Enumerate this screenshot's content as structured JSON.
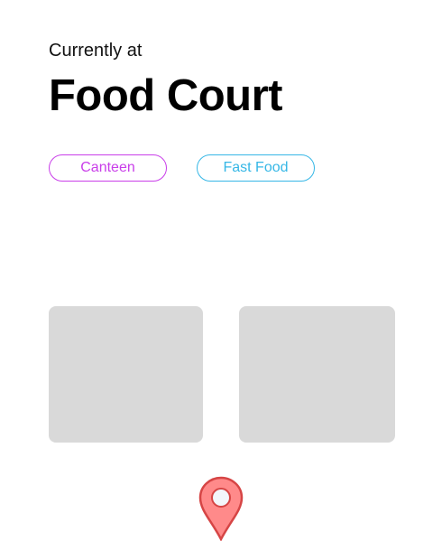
{
  "header": {
    "subtitle": "Currently at",
    "title": "Food Court"
  },
  "chips": [
    {
      "label": "Canteen",
      "color": "#c93ee9"
    },
    {
      "label": "Fast Food",
      "color": "#36b7e6"
    }
  ],
  "cards": [
    {
      "color": "#d9d9d9"
    },
    {
      "color": "#d9d9d9"
    }
  ],
  "map_pin": {
    "icon": "location-pin-icon",
    "fill_color": "#ff8a8a",
    "stroke_color": "#d64545",
    "center_color": "#f3f6fb"
  }
}
